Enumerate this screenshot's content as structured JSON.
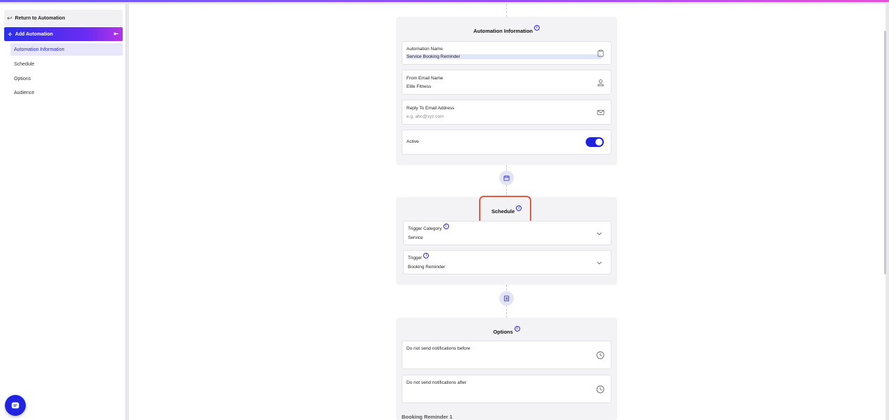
{
  "sidebar": {
    "return_label": "Return to Automation",
    "header_label": "Add Automation",
    "items": [
      {
        "label": "Automation Information",
        "active": true
      },
      {
        "label": "Schedule",
        "active": false
      },
      {
        "label": "Options",
        "active": false
      },
      {
        "label": "Audience",
        "active": false
      }
    ]
  },
  "automation_info": {
    "title": "Automation Information",
    "info_icon": "ⓘ",
    "name_label": "Automation Name",
    "name_value": "Service Booking Reminder",
    "from_label": "From Email Name",
    "from_value": "Elite Fitness",
    "reply_label": "Reply To Email Address",
    "reply_placeholder": "e.g. abc@xyz.com",
    "active_label": "Active",
    "active_value": true
  },
  "schedule": {
    "title": "Schedule",
    "trigger_category_label": "Trigger Category",
    "trigger_category_value": "Service",
    "trigger_label": "Trigger",
    "trigger_value": "Booking Reminder"
  },
  "options": {
    "title": "Options",
    "before_label": "Do not send notifications before",
    "after_label": "Do not send notifications after",
    "reminder_heading": "Booking Reminder 1"
  },
  "icons": {
    "return": "arrow-left-icon",
    "add": "magic-wand-icon",
    "collapse": "collapse-left-icon",
    "chat": "chat-icon",
    "clipboard": "clipboard-icon",
    "person": "person-icon",
    "mail": "mail-icon",
    "calendar": "calendar-icon",
    "list": "list-icon",
    "clock": "clock-icon",
    "chevron": "chevron-down-icon"
  },
  "colors": {
    "accent": "#1f23e0",
    "highlight_outline": "#e25a45"
  }
}
